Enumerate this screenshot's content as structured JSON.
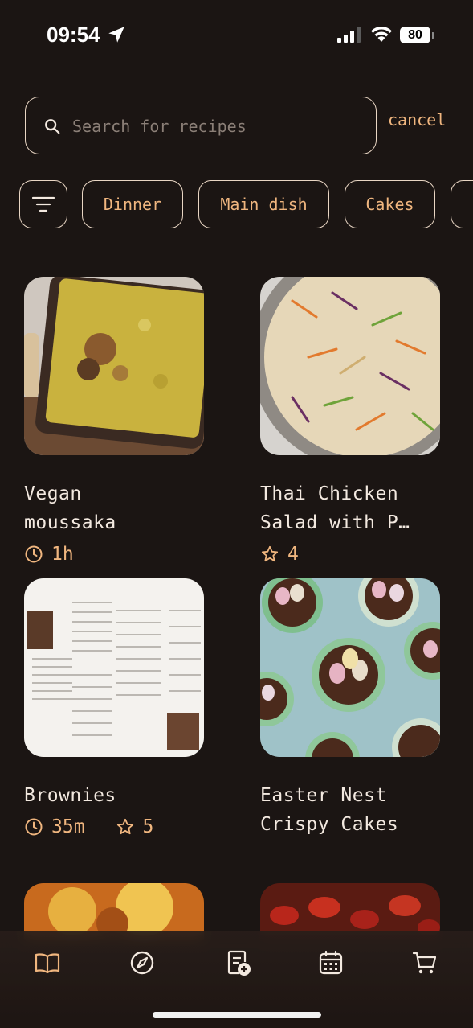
{
  "status": {
    "time": "09:54",
    "battery": "80"
  },
  "search": {
    "placeholder": "Search for recipes",
    "value": "",
    "cancel_label": "cancel"
  },
  "filters": [
    "Dinner",
    "Main dish",
    "Cakes"
  ],
  "recipes": [
    {
      "title_l1": "Vegan",
      "title_l2": "moussaka",
      "time": "1h",
      "rating": ""
    },
    {
      "title_l1": "Thai Chicken",
      "title_l2": "Salad with P…",
      "time": "",
      "rating": "4"
    },
    {
      "title_l1": "Brownies",
      "title_l2": "",
      "time": "35m",
      "rating": "5"
    },
    {
      "title_l1": "Easter Nest",
      "title_l2": "Crispy Cakes",
      "time": "",
      "rating": ""
    }
  ],
  "colors": {
    "background": "#1b1513",
    "accent": "#f0b67f",
    "border": "#e9d6c4"
  },
  "tabs": [
    "book-icon",
    "compass-icon",
    "add-recipe-icon",
    "calendar-icon",
    "cart-icon"
  ]
}
